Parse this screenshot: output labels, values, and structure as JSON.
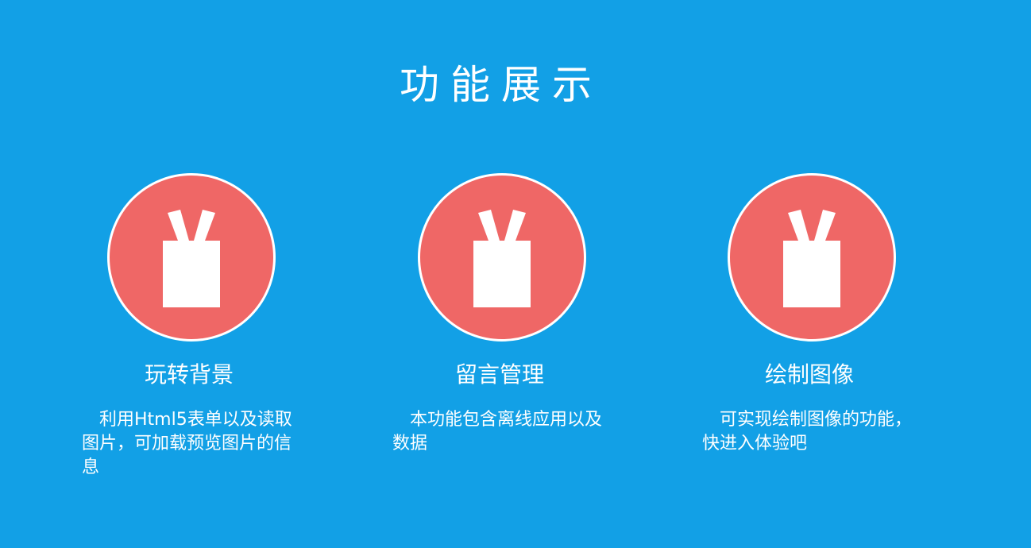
{
  "page": {
    "title": "功能展示",
    "background_color": "#12a0e6",
    "accent_color": "#ef6766"
  },
  "features": [
    {
      "icon": "vest-icon",
      "title": "玩转背景",
      "description": "利用Html5表单以及读取图片，可加载预览图片的信息"
    },
    {
      "icon": "vest-icon",
      "title": "留言管理",
      "description": "本功能包含离线应用以及数据"
    },
    {
      "icon": "vest-icon",
      "title": "绘制图像",
      "description": "可实现绘制图像的功能，快进入体验吧"
    }
  ]
}
